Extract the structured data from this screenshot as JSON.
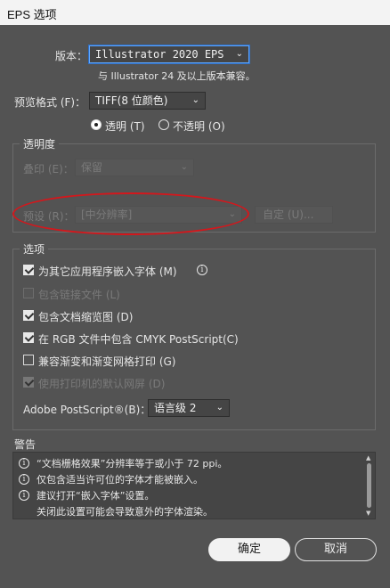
{
  "window": {
    "title": "EPS 选项"
  },
  "version": {
    "label": "版本：",
    "value": "Illustrator 2020 EPS",
    "note": "与 Illustrator 24 及以上版本兼容。"
  },
  "preview": {
    "format_label": "预览格式 (F)：",
    "format_value": "TIFF(8 位颜色)",
    "transparent_label": "透明 (T)",
    "opaque_label": "不透明 (O)",
    "transparent_selected": true
  },
  "transparency": {
    "title": "透明度",
    "overprint_label": "叠印 (E)：",
    "overprint_value": "保留",
    "preset_label": "预设 (R)：",
    "preset_value": "[中分辨率]",
    "custom_button": "自定 (U)..."
  },
  "options": {
    "title": "选项",
    "items": [
      {
        "label": "为其它应用程序嵌入字体 (M)",
        "checked": true,
        "enabled": true
      },
      {
        "label": "包含链接文件 (L)",
        "checked": false,
        "enabled": false
      },
      {
        "label": "包含文档缩览图 (D)",
        "checked": true,
        "enabled": true
      },
      {
        "label": "在 RGB 文件中包含 CMYK PostScript(C)",
        "checked": true,
        "enabled": true
      },
      {
        "label": "兼容渐变和渐变网格打印 (G)",
        "checked": false,
        "enabled": true
      },
      {
        "label": "使用打印机的默认网屏 (D)",
        "checked": true,
        "enabled": false
      }
    ],
    "postscript_label": "Adobe PostScript®(B)：",
    "postscript_value": "语言级 2"
  },
  "warnings": {
    "title": "警告",
    "lines": [
      "“文档栅格效果”分辨率等于或小于 72 ppi。",
      "仅包含适当许可位的字体才能被嵌入。",
      "建议打开“嵌入字体”设置。",
      "关闭此设置可能会导致意外的字体渲染。"
    ]
  },
  "buttons": {
    "ok": "确定",
    "cancel": "取消"
  },
  "colors": {
    "background": "#535353",
    "annotation_ellipse": "#d4171c",
    "focus": "#5ea7ff"
  }
}
